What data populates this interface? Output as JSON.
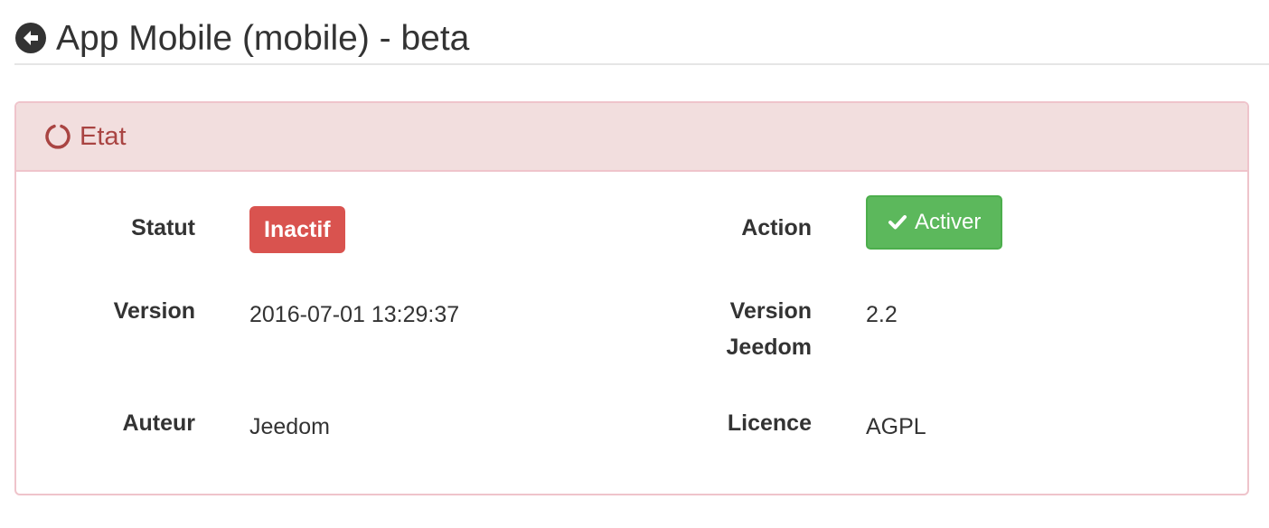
{
  "header": {
    "title": "App Mobile (mobile) - beta",
    "back_icon": "arrow-circle-left-icon"
  },
  "panel": {
    "title": "Etat",
    "icon": "circle-notch-icon",
    "colors": {
      "heading_bg": "#f2dede",
      "heading_text": "#a94442",
      "border": "#efc4cb"
    }
  },
  "fields": {
    "statut_label": "Statut",
    "statut_value": "Inactif",
    "action_label": "Action",
    "action_button": "Activer",
    "version_label": "Version",
    "version_value": "2016-07-01 13:29:37",
    "jeedom_version_label_1": "Version",
    "jeedom_version_label_2": "Jeedom",
    "jeedom_version_value": "2.2",
    "auteur_label": "Auteur",
    "auteur_value": "Jeedom",
    "licence_label": "Licence",
    "licence_value": "AGPL"
  },
  "colors": {
    "badge_danger": "#d9534f",
    "button_success": "#5cb85c"
  }
}
